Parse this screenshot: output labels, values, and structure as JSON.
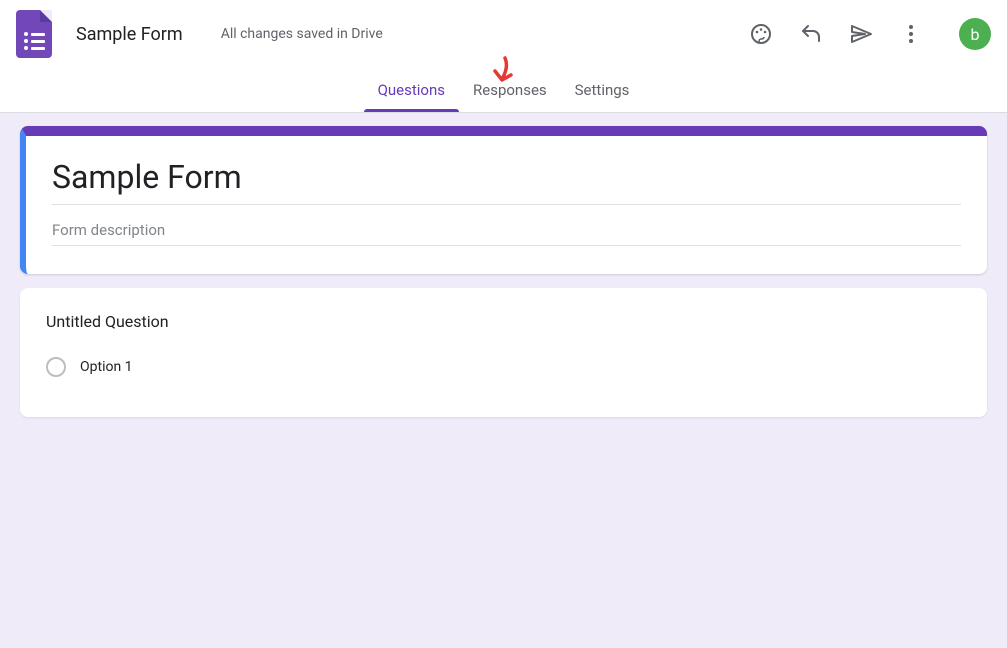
{
  "header": {
    "form_title": "Sample Form",
    "save_status": "All changes saved in Drive",
    "avatar_letter": "b"
  },
  "tabs": {
    "questions": "Questions",
    "responses": "Responses",
    "settings": "Settings"
  },
  "title_card": {
    "title": "Sample Form",
    "description_placeholder": "Form description"
  },
  "question_card": {
    "title": "Untitled Question",
    "option1": "Option 1"
  },
  "colors": {
    "primary": "#673ab7",
    "accent": "#4285f4",
    "avatar": "#4caf50"
  }
}
